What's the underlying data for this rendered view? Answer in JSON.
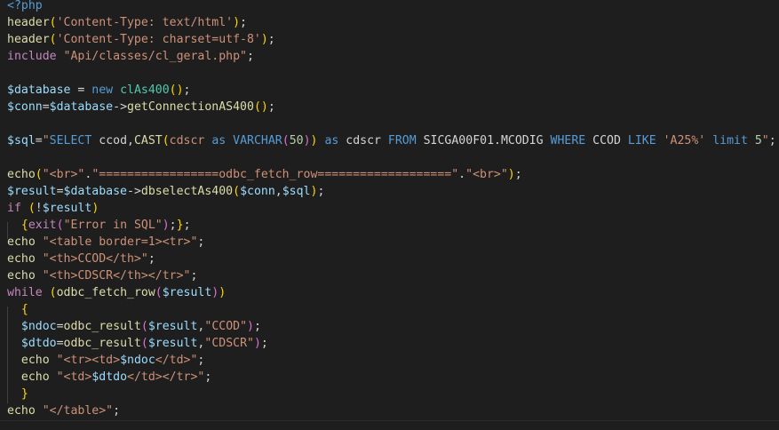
{
  "editor": {
    "language": "php",
    "colors": {
      "background": "#1e1e1e",
      "plain": "#d4d4d4",
      "keyword_blue": "#569cd6",
      "control_purple": "#c586c0",
      "function_yellow": "#dcdcaa",
      "string_orange": "#ce9178",
      "variable_lightblue": "#9cdcfe",
      "type_teal": "#4ec9b0",
      "number_green": "#b5cea8",
      "bracket_gold": "#ffd700",
      "bracket_pink": "#da70d6",
      "bracket_blue": "#179fff"
    },
    "lines": [
      [
        [
          "<?php",
          "keyword_blue"
        ]
      ],
      [
        [
          "header",
          "function_yellow"
        ],
        [
          "(",
          "bracket_gold"
        ],
        [
          "'Content-Type: text/html'",
          "string_orange"
        ],
        [
          ")",
          "bracket_gold"
        ],
        [
          ";",
          "plain"
        ]
      ],
      [
        [
          "header",
          "function_yellow"
        ],
        [
          "(",
          "bracket_gold"
        ],
        [
          "'Content-Type: charset=utf-8'",
          "string_orange"
        ],
        [
          ")",
          "bracket_gold"
        ],
        [
          ";",
          "plain"
        ]
      ],
      [
        [
          "include",
          "control_purple"
        ],
        [
          " ",
          "plain"
        ],
        [
          "\"Api/classes/cl_geral.php\"",
          "string_orange"
        ],
        [
          ";",
          "plain"
        ]
      ],
      [],
      [
        [
          "$database",
          "variable_lightblue"
        ],
        [
          " = ",
          "plain"
        ],
        [
          "new",
          "keyword_blue"
        ],
        [
          " ",
          "plain"
        ],
        [
          "clAs400",
          "type_teal"
        ],
        [
          "()",
          "bracket_gold"
        ],
        [
          ";",
          "plain"
        ]
      ],
      [
        [
          "$conn",
          "variable_lightblue"
        ],
        [
          "=",
          "plain"
        ],
        [
          "$database",
          "variable_lightblue"
        ],
        [
          "->",
          "plain"
        ],
        [
          "getConnectionAS400",
          "function_yellow"
        ],
        [
          "()",
          "bracket_gold"
        ],
        [
          ";",
          "plain"
        ]
      ],
      [],
      [
        [
          "$sql",
          "variable_lightblue"
        ],
        [
          "=",
          "plain"
        ],
        [
          "\"",
          "string_orange"
        ],
        [
          "SELECT",
          "keyword_blue"
        ],
        [
          " ccod,",
          "plain"
        ],
        [
          "CAST",
          "function_yellow"
        ],
        [
          "(",
          "bracket_gold"
        ],
        [
          "cdscr ",
          "string_orange"
        ],
        [
          "as",
          "keyword_blue"
        ],
        [
          " ",
          "plain"
        ],
        [
          "VARCHAR",
          "keyword_blue"
        ],
        [
          "(",
          "bracket_pink"
        ],
        [
          "50",
          "number_green"
        ],
        [
          ")",
          "bracket_pink"
        ],
        [
          ")",
          "bracket_gold"
        ],
        [
          " ",
          "plain"
        ],
        [
          "as",
          "keyword_blue"
        ],
        [
          " cdscr ",
          "plain"
        ],
        [
          "FROM",
          "keyword_blue"
        ],
        [
          " SICGA00F01.MCODIG ",
          "plain"
        ],
        [
          "WHERE",
          "keyword_blue"
        ],
        [
          " CCOD ",
          "plain"
        ],
        [
          "LIKE",
          "keyword_blue"
        ],
        [
          " ",
          "plain"
        ],
        [
          "'A25%'",
          "string_orange"
        ],
        [
          " ",
          "plain"
        ],
        [
          "limit",
          "keyword_blue"
        ],
        [
          " ",
          "plain"
        ],
        [
          "5",
          "number_green"
        ],
        [
          "\"",
          "string_orange"
        ],
        [
          ";",
          "plain"
        ]
      ],
      [],
      [
        [
          "echo",
          "function_yellow"
        ],
        [
          "(",
          "bracket_gold"
        ],
        [
          "\"<br>\"",
          "string_orange"
        ],
        [
          ".",
          "plain"
        ],
        [
          "\"=================odbc_fetch_row===================\"",
          "string_orange"
        ],
        [
          ".",
          "plain"
        ],
        [
          "\"<br>\"",
          "string_orange"
        ],
        [
          ")",
          "bracket_gold"
        ],
        [
          ";",
          "plain"
        ]
      ],
      [
        [
          "$result",
          "variable_lightblue"
        ],
        [
          "=",
          "plain"
        ],
        [
          "$database",
          "variable_lightblue"
        ],
        [
          "->",
          "plain"
        ],
        [
          "dbselectAs400",
          "function_yellow"
        ],
        [
          "(",
          "bracket_gold"
        ],
        [
          "$conn",
          "variable_lightblue"
        ],
        [
          ",",
          "plain"
        ],
        [
          "$sql",
          "variable_lightblue"
        ],
        [
          ")",
          "bracket_gold"
        ],
        [
          ";",
          "plain"
        ]
      ],
      [
        [
          "if",
          "control_purple"
        ],
        [
          " ",
          "plain"
        ],
        [
          "(",
          "bracket_gold"
        ],
        [
          "!",
          "plain"
        ],
        [
          "$result",
          "variable_lightblue"
        ],
        [
          ")",
          "bracket_gold"
        ]
      ],
      [
        [
          "  ",
          "plain"
        ],
        [
          "{",
          "bracket_gold"
        ],
        [
          "exit",
          "control_purple"
        ],
        [
          "(",
          "bracket_pink"
        ],
        [
          "\"Error in SQL\"",
          "string_orange"
        ],
        [
          ")",
          "bracket_pink"
        ],
        [
          ";",
          "plain"
        ],
        [
          "}",
          "bracket_gold"
        ],
        [
          ";",
          "plain"
        ]
      ],
      [
        [
          "echo",
          "function_yellow"
        ],
        [
          " ",
          "plain"
        ],
        [
          "\"<table border=1><tr>\"",
          "string_orange"
        ],
        [
          ";",
          "plain"
        ]
      ],
      [
        [
          "echo",
          "function_yellow"
        ],
        [
          " ",
          "plain"
        ],
        [
          "\"<th>CCOD</th>\"",
          "string_orange"
        ],
        [
          ";",
          "plain"
        ]
      ],
      [
        [
          "echo",
          "function_yellow"
        ],
        [
          " ",
          "plain"
        ],
        [
          "\"<th>CDSCR</th></tr>\"",
          "string_orange"
        ],
        [
          ";",
          "plain"
        ]
      ],
      [
        [
          "while",
          "control_purple"
        ],
        [
          " ",
          "plain"
        ],
        [
          "(",
          "bracket_gold"
        ],
        [
          "odbc_fetch_row",
          "function_yellow"
        ],
        [
          "(",
          "bracket_pink"
        ],
        [
          "$result",
          "variable_lightblue"
        ],
        [
          ")",
          "bracket_pink"
        ],
        [
          ")",
          "bracket_gold"
        ]
      ],
      [
        [
          "  ",
          "plain"
        ],
        [
          "{",
          "bracket_gold"
        ]
      ],
      [
        [
          "  ",
          "plain"
        ],
        [
          "$ndoc",
          "variable_lightblue"
        ],
        [
          "=",
          "plain"
        ],
        [
          "odbc_result",
          "function_yellow"
        ],
        [
          "(",
          "bracket_pink"
        ],
        [
          "$result",
          "variable_lightblue"
        ],
        [
          ",",
          "plain"
        ],
        [
          "\"CCOD\"",
          "string_orange"
        ],
        [
          ")",
          "bracket_pink"
        ],
        [
          ";",
          "plain"
        ]
      ],
      [
        [
          "  ",
          "plain"
        ],
        [
          "$dtdo",
          "variable_lightblue"
        ],
        [
          "=",
          "plain"
        ],
        [
          "odbc_result",
          "function_yellow"
        ],
        [
          "(",
          "bracket_pink"
        ],
        [
          "$result",
          "variable_lightblue"
        ],
        [
          ",",
          "plain"
        ],
        [
          "\"CDSCR\"",
          "string_orange"
        ],
        [
          ")",
          "bracket_pink"
        ],
        [
          ";",
          "plain"
        ]
      ],
      [
        [
          "  ",
          "plain"
        ],
        [
          "echo",
          "function_yellow"
        ],
        [
          " ",
          "plain"
        ],
        [
          "\"<tr><td>",
          "string_orange"
        ],
        [
          "$ndoc",
          "variable_lightblue"
        ],
        [
          "</td>\"",
          "string_orange"
        ],
        [
          ";",
          "plain"
        ]
      ],
      [
        [
          "  ",
          "plain"
        ],
        [
          "echo",
          "function_yellow"
        ],
        [
          " ",
          "plain"
        ],
        [
          "\"<td>",
          "string_orange"
        ],
        [
          "$dtdo",
          "variable_lightblue"
        ],
        [
          "</td></tr>\"",
          "string_orange"
        ],
        [
          ";",
          "plain"
        ]
      ],
      [
        [
          "  ",
          "plain"
        ],
        [
          "}",
          "bracket_gold"
        ]
      ],
      [
        [
          "echo",
          "function_yellow"
        ],
        [
          " ",
          "plain"
        ],
        [
          "\"</table>\"",
          "string_orange"
        ],
        [
          ";",
          "plain"
        ]
      ]
    ]
  }
}
